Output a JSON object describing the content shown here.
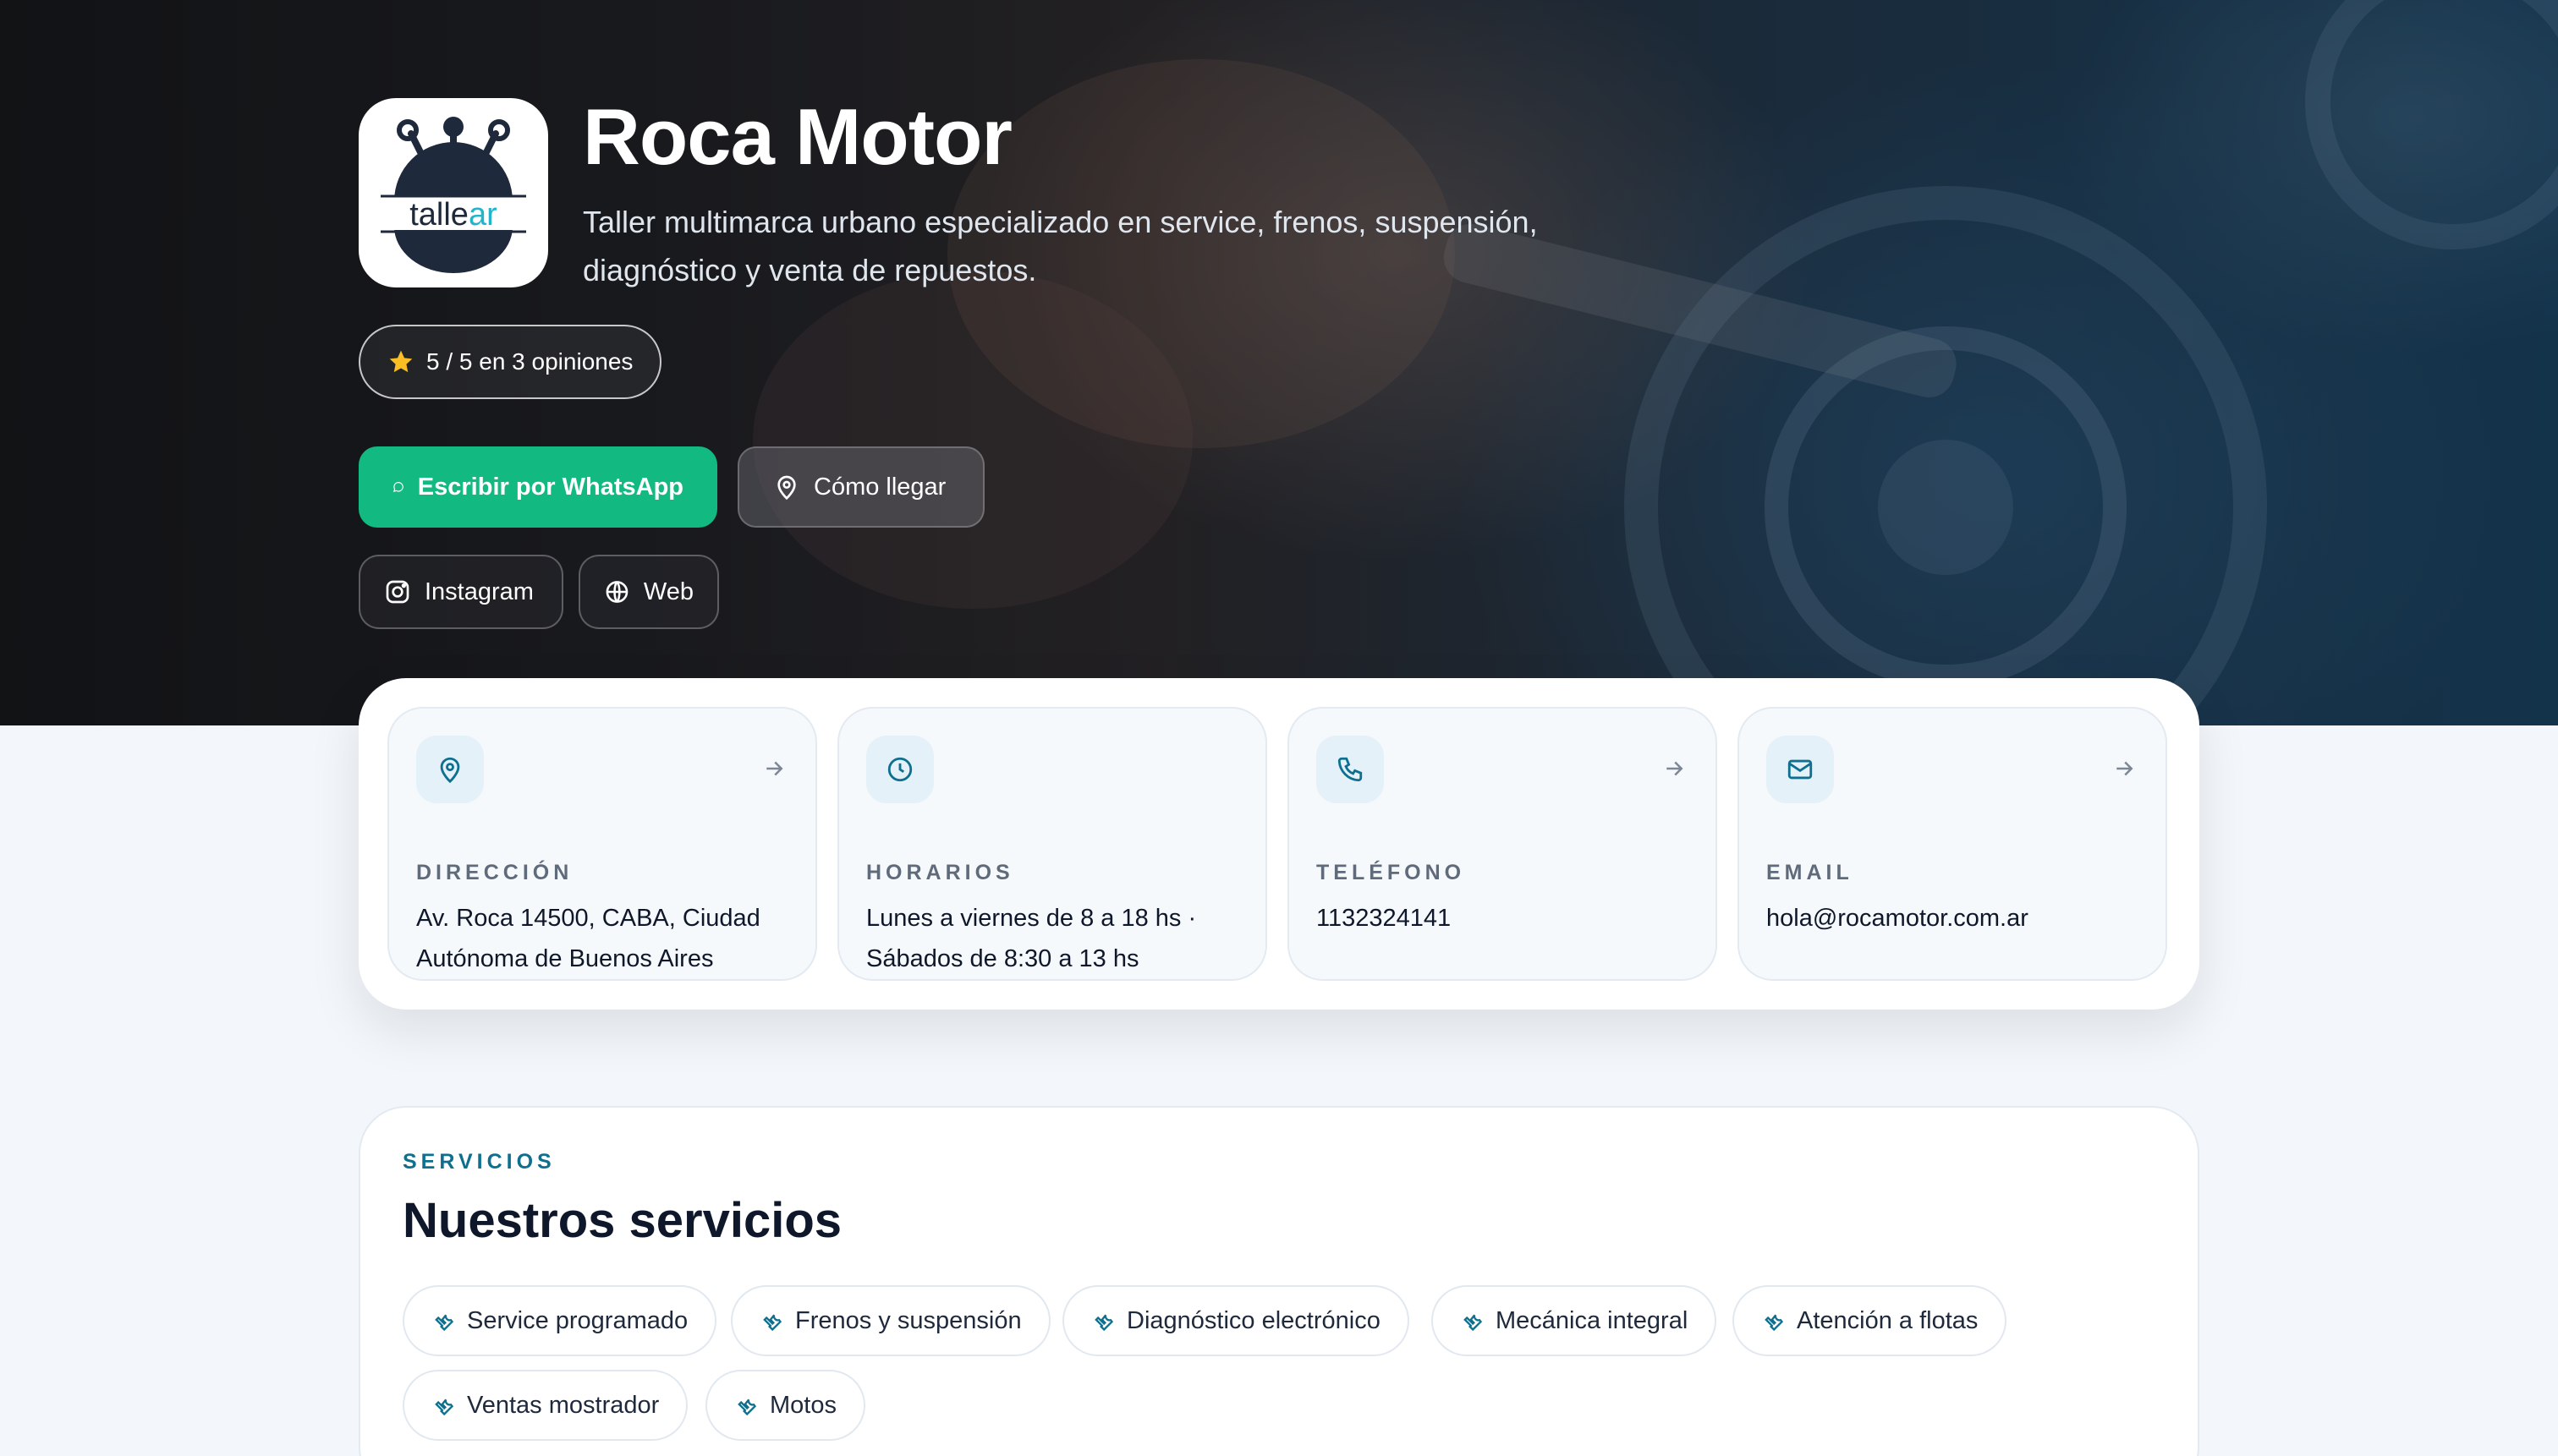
{
  "business": {
    "name": "Roca Motor",
    "description": "Taller multimarca urbano especializado en service, frenos, suspensión, diagnóstico y venta de repuestos.",
    "logo_text_a": "talle",
    "logo_text_b": "ar",
    "rating_text": "5 / 5 en 3 opiniones"
  },
  "actions": {
    "whatsapp": "Escribir por WhatsApp",
    "directions": "Cómo llegar",
    "instagram": "Instagram",
    "web": "Web"
  },
  "info": [
    {
      "label": "DIRECCIÓN",
      "value": "Av. Roca 14500, CABA, Ciudad Autónoma de Buenos Aires",
      "icon": "map-pin-icon",
      "has_arrow": true
    },
    {
      "label": "HORARIOS",
      "value": "Lunes a viernes de 8 a 18 hs · Sábados de 8:30 a 13 hs",
      "icon": "clock-icon",
      "has_arrow": false
    },
    {
      "label": "TELÉFONO",
      "value": "1132324141",
      "icon": "phone-icon",
      "has_arrow": true
    },
    {
      "label": "EMAIL",
      "value": "hola@rocamotor.com.ar",
      "icon": "mail-icon",
      "has_arrow": true
    }
  ],
  "services": {
    "eyebrow": "SERVICIOS",
    "title": "Nuestros servicios",
    "items": [
      "Service programado",
      "Frenos y suspensión",
      "Diagnóstico electrónico",
      "Mecánica integral",
      "Atención a flotas",
      "Ventas mostrador",
      "Motos"
    ]
  },
  "colors": {
    "whatsapp_green": "#12b981",
    "accent_teal": "#0e6f8f",
    "star_yellow": "#fbbf24",
    "logo_cyan": "#22b5c9"
  }
}
